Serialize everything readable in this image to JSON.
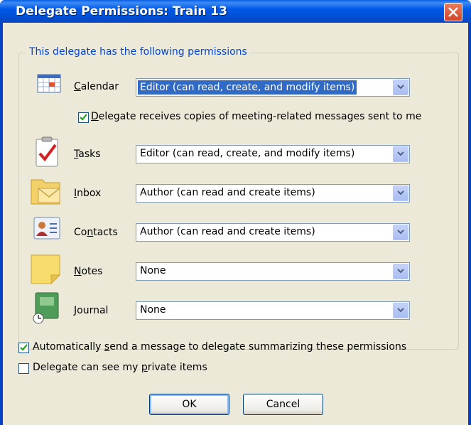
{
  "window": {
    "title": "Delegate Permissions: Train 13"
  },
  "group": {
    "legend": "This delegate has the following permissions"
  },
  "rows": [
    {
      "key": "calendar",
      "label_pre": "",
      "label_u": "C",
      "label_post": "alendar",
      "value": "Editor (can read, create, and modify items)"
    },
    {
      "key": "tasks",
      "label_pre": "",
      "label_u": "T",
      "label_post": "asks",
      "value": "Editor (can read, create, and modify items)"
    },
    {
      "key": "inbox",
      "label_pre": "",
      "label_u": "I",
      "label_post": "nbox",
      "value": "Author (can read and create items)"
    },
    {
      "key": "contacts",
      "label_pre": "Co",
      "label_u": "n",
      "label_post": "tacts",
      "value": "Author (can read and create items)"
    },
    {
      "key": "notes",
      "label_pre": "",
      "label_u": "N",
      "label_post": "otes",
      "value": "None"
    },
    {
      "key": "journal",
      "label_pre": "",
      "label_u": "J",
      "label_post": "ournal",
      "value": "None"
    }
  ],
  "meeting_copies": {
    "pre": "",
    "u": "D",
    "post": "elegate receives copies of meeting-related messages sent to me",
    "checked": true
  },
  "auto_send": {
    "pre": "Automatically ",
    "u": "s",
    "post": "end a message to delegate summarizing these permissions",
    "checked": true
  },
  "private_items": {
    "pre": "Delegate can see my ",
    "u": "p",
    "post": "rivate items",
    "checked": false
  },
  "buttons": {
    "ok": "OK",
    "cancel": "Cancel"
  },
  "icons": {
    "close": "close-icon",
    "dropdown": "chevron-down-icon",
    "calendar": "calendar-icon",
    "tasks": "tasks-icon",
    "inbox": "inbox-icon",
    "contacts": "contacts-icon",
    "notes": "notes-icon",
    "journal": "journal-icon"
  },
  "colors": {
    "title_bar": "#0058e6",
    "dialog_bg": "#ece9d8",
    "legend_text": "#0046d5",
    "selection": "#316ac5",
    "close_button": "#d2452a",
    "check_mark": "#21a121"
  }
}
